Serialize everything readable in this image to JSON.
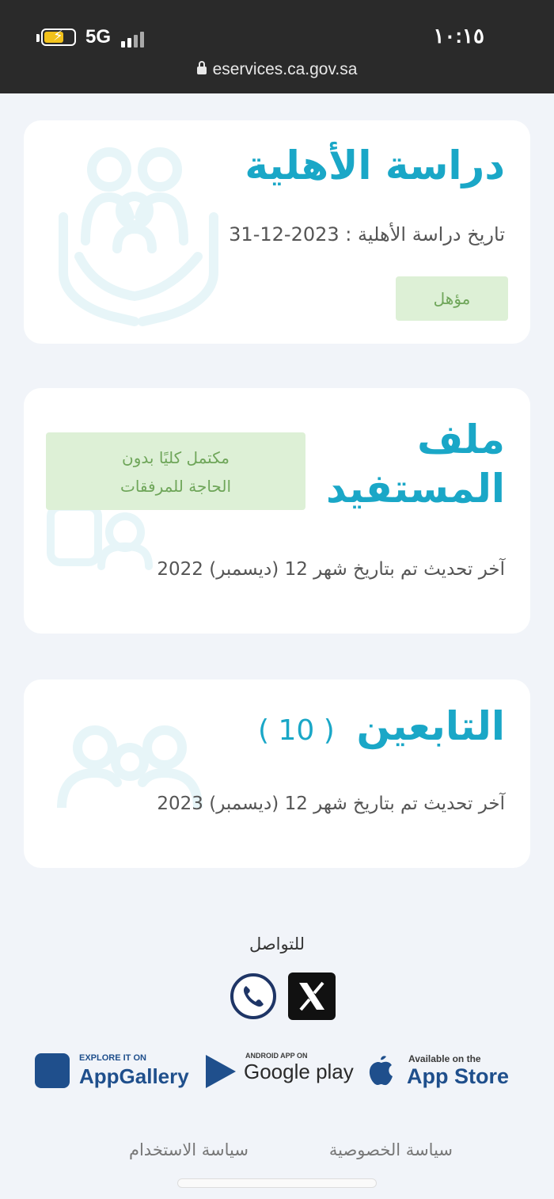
{
  "status_bar": {
    "network": "5G",
    "time": "١٠:١٥",
    "url": "eservices.ca.gov.sa"
  },
  "eligibility": {
    "title": "دراسة الأهلية",
    "date_line": "تاريخ دراسة الأهلية : 2023-12-31",
    "status_badge": "مؤهل"
  },
  "beneficiary": {
    "title_line1": "ملف",
    "title_line2": "المستفيد",
    "status_line1": "مكتمل كليًا بدون",
    "status_line2": "الحاجة للمرفقات",
    "last_update": "آخر تحديث تم بتاريخ شهر 12 (ديسمبر) 2022"
  },
  "dependents": {
    "title": "التابعين",
    "count": "( 10 )",
    "last_update": "آخر تحديث تم بتاريخ شهر 12 (ديسمبر) 2023"
  },
  "footer": {
    "contact_label": "للتواصل",
    "stores": {
      "appgallery_small": "EXPLORE IT ON",
      "appgallery_big": "AppGallery",
      "googleplay_small": "ANDROID APP ON",
      "googleplay_big": "Google play",
      "appstore_small": "Available on the",
      "appstore_big": "App Store"
    },
    "privacy_link": "سياسة الخصوصية",
    "terms_link": "سياسة الاستخدام"
  }
}
